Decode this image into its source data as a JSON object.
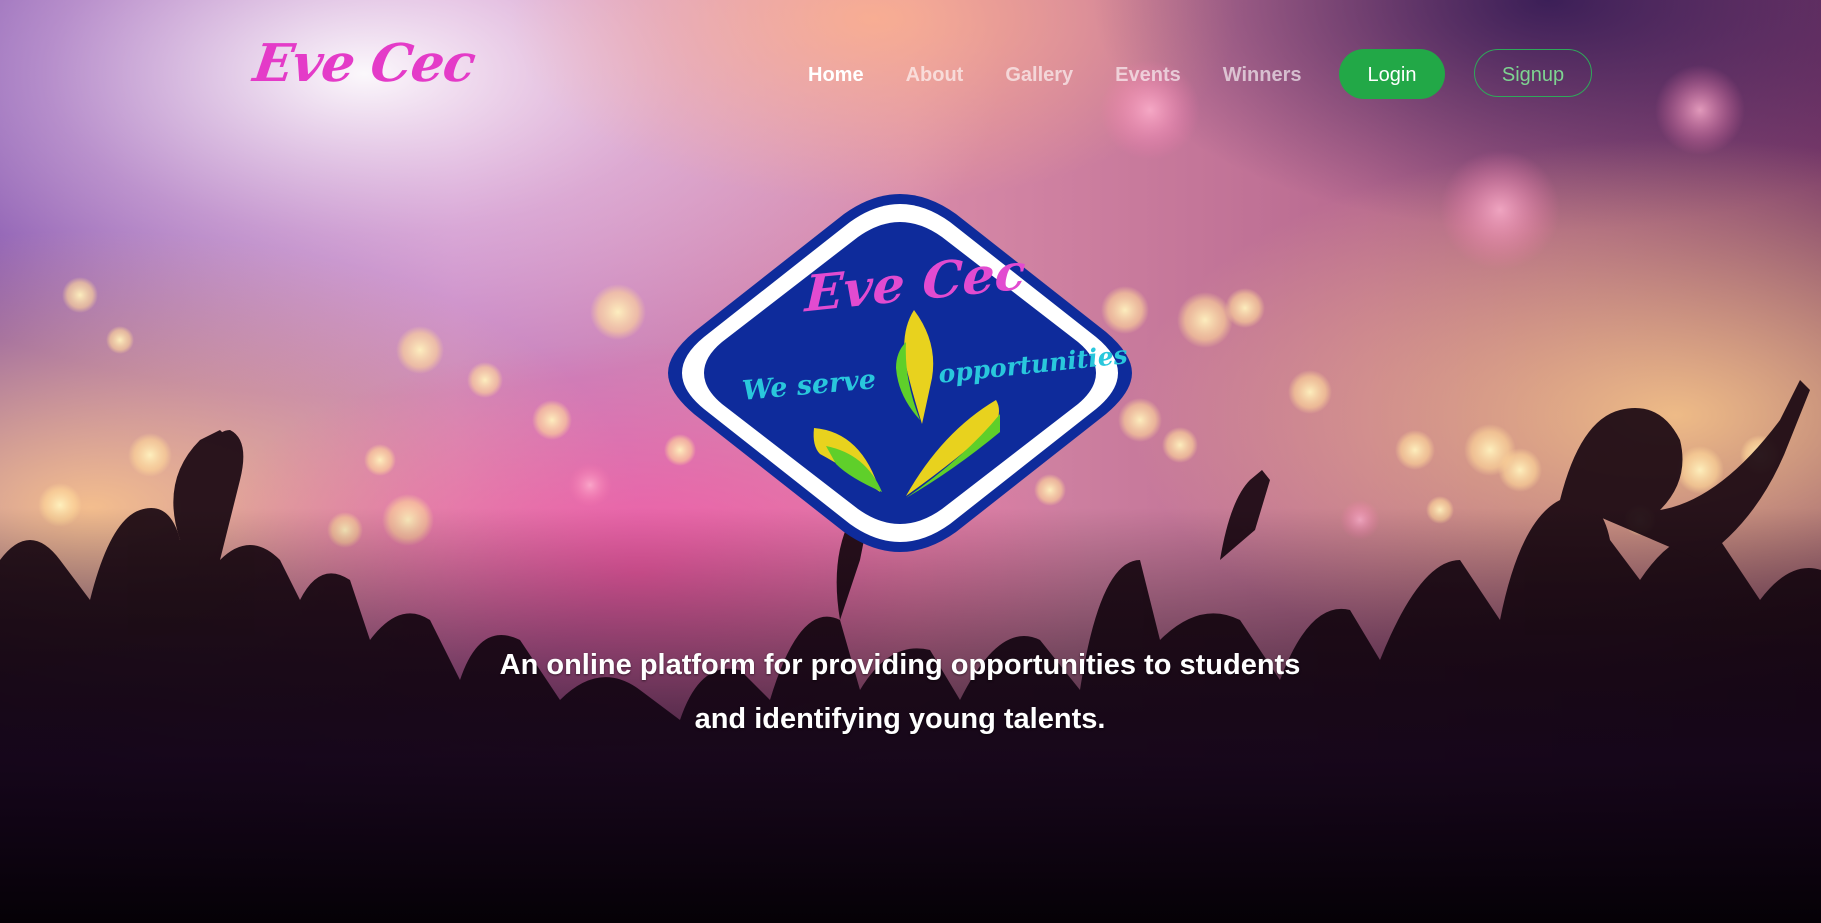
{
  "brand": {
    "name": "Eve Cec",
    "color": "#e43bc8"
  },
  "nav": {
    "items": [
      {
        "label": "Home",
        "active": true
      },
      {
        "label": "About",
        "active": false
      },
      {
        "label": "Gallery",
        "active": false
      },
      {
        "label": "Events",
        "active": false
      },
      {
        "label": "Winners",
        "active": false
      }
    ],
    "login_label": "Login",
    "signup_label": "Signup",
    "login_color": "#22a847",
    "signup_color": "#2fa85a"
  },
  "emblem": {
    "brand": "Eve Cec",
    "left_text": "We serve",
    "right_text": "opportunities",
    "fill_color": "#0e2b9b",
    "border_color": "#ffffff",
    "brand_color": "#e24bd0",
    "text_color": "#29c7dc",
    "icon": "sprout-leaves-icon"
  },
  "hero": {
    "background": "concert-crowd-silhouette-bokeh",
    "tagline_line1": "An online platform for providing opportunities to students",
    "tagline_line2": "and identifying young talents."
  }
}
